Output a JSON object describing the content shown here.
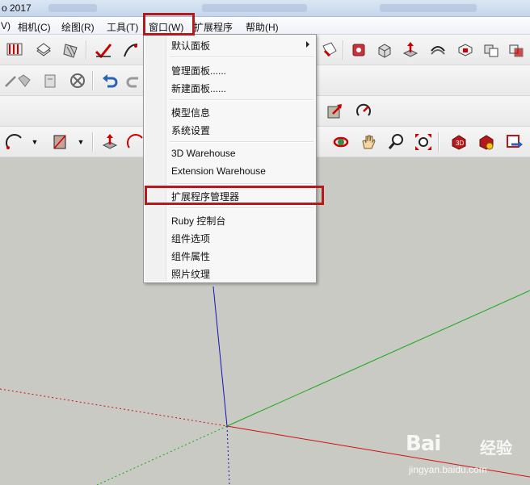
{
  "window": {
    "title_fragment": "o 2017"
  },
  "menubar": {
    "items": [
      {
        "label": "V)"
      },
      {
        "label": "相机(C)"
      },
      {
        "label": "绘图(R)"
      },
      {
        "label": "工具(T)"
      },
      {
        "label": "窗口(W)"
      },
      {
        "label": "扩展程序"
      },
      {
        "label": "帮助(H)"
      }
    ]
  },
  "window_menu": {
    "items": [
      {
        "label": "默认面板",
        "has_submenu": true
      },
      {
        "label": "管理面板......"
      },
      {
        "label": "新建面板......"
      },
      {
        "label": "模型信息"
      },
      {
        "label": "系统设置"
      },
      {
        "label": "3D Warehouse"
      },
      {
        "label": "Extension Warehouse"
      },
      {
        "label": "扩展程序管理器",
        "highlighted": true
      },
      {
        "label": "Ruby 控制台"
      },
      {
        "label": "组件选项"
      },
      {
        "label": "组件属性"
      },
      {
        "label": "照片纹理"
      }
    ]
  },
  "watermark": {
    "logo": "Bai",
    "logo_tail": "经验",
    "url": "jingyan.baidu.com"
  },
  "colors": {
    "axis_red": "#d01010",
    "axis_green": "#18a818",
    "axis_blue": "#1414b4",
    "highlight_box": "#b5191b",
    "viewport_bg": "#c9cac4"
  }
}
